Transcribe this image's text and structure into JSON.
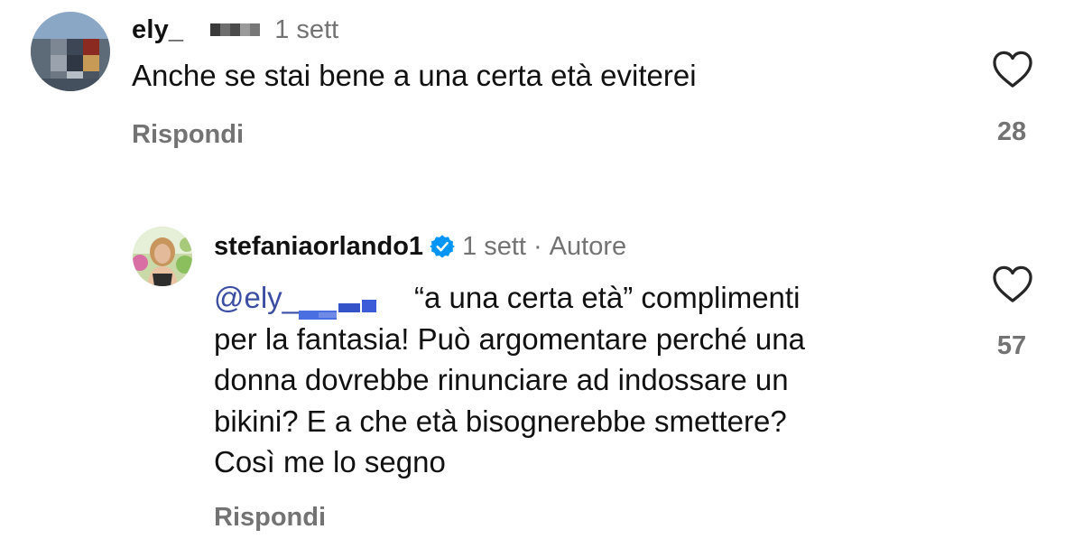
{
  "comments": [
    {
      "username": "ely_",
      "time": "1 sett",
      "text": "Anche se stai bene a una certa età eviterei",
      "reply_label": "Rispondi",
      "likes": "28",
      "avatar_icon": "user-avatar-pixelated",
      "like_icon": "heart-outline-icon"
    },
    {
      "username": "stefaniaorlando1",
      "verified": true,
      "time": "1 sett",
      "separator": "·",
      "role": "Autore",
      "mention": "@ely_",
      "body_lines": [
        "“a una certa età” complimenti",
        "per la fantasia! Può argomentare perché una",
        "donna dovrebbe rinunciare ad indossare un",
        "bikini? E a che età bisognerebbe smettere?",
        "Così me lo segno"
      ],
      "reply_label": "Rispondi",
      "likes": "57",
      "avatar_icon": "user-avatar-photo",
      "like_icon": "heart-outline-icon"
    }
  ],
  "colors": {
    "text": "#111111",
    "secondary": "#737373",
    "mention": "#3b4ea3",
    "verified": "#0095f6"
  }
}
